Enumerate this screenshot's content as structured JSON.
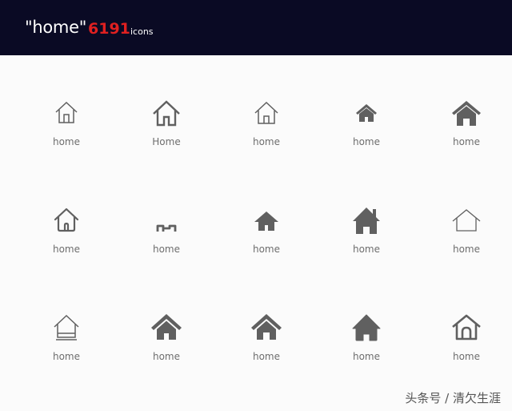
{
  "header": {
    "query": "\"home\"",
    "count": "6191",
    "unit": "icons",
    "background": "#0a0a24",
    "count_color": "#e02020"
  },
  "icons": [
    {
      "label": "home",
      "icon": "house-outline-thin-icon"
    },
    {
      "label": "Home",
      "icon": "house-outline-icon"
    },
    {
      "label": "home",
      "icon": "house-outline-small-icon"
    },
    {
      "label": "home",
      "icon": "house-solid-small-icon"
    },
    {
      "label": "home",
      "icon": "house-solid-icon"
    },
    {
      "label": "home",
      "icon": "house-rounded-outline-icon"
    },
    {
      "label": "home",
      "icon": "house-wave-outline-icon"
    },
    {
      "label": "home",
      "icon": "house-solid-small-flat-icon"
    },
    {
      "label": "home",
      "icon": "house-solid-chimney-icon"
    },
    {
      "label": "home",
      "icon": "house-outline-minimal-icon"
    },
    {
      "label": "home",
      "icon": "house-outline-base-icon"
    },
    {
      "label": "home",
      "icon": "house-solid-door-icon"
    },
    {
      "label": "home",
      "icon": "house-solid-door-alt-icon"
    },
    {
      "label": "home",
      "icon": "house-solid-rounded-icon"
    },
    {
      "label": "home",
      "icon": "house-outline-door-icon"
    }
  ],
  "watermark": "头条号 / 清欠生涯",
  "icon_color": "#606060"
}
